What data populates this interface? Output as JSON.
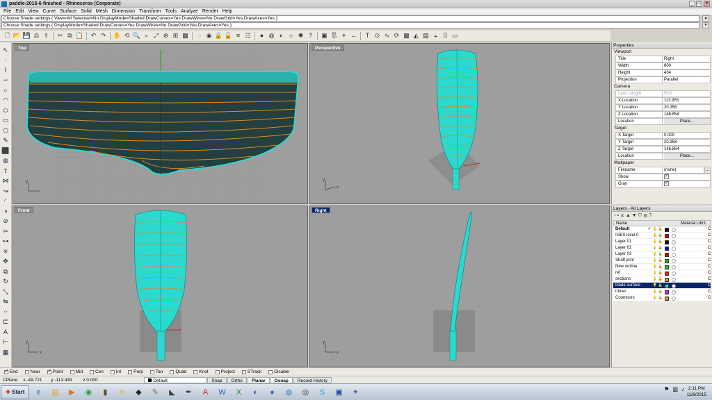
{
  "window": {
    "title": "paddle-2016-6-finished - Rhinoceros (Corporate)",
    "minimize": "_",
    "maximize": "□",
    "close": "✕"
  },
  "menu": [
    "File",
    "Edit",
    "View",
    "Curve",
    "Surface",
    "Solid",
    "Mesh",
    "Dimension",
    "Transform",
    "Tools",
    "Analyze",
    "Render",
    "Help"
  ],
  "command": {
    "history": "Choose Shade settings ( View=All  Selected=No  DisplayMode=Shaded  DrawCurves=Yes  DrawWires=No  DrawGrid=Yes  DrawAxes=Yes ):",
    "prompt": "Choose Shade settings ( DisplayMode=Shaded  DrawCurves=Yes  DrawWires=No  DrawGrid=Yes  DrawAxes=Yes ):"
  },
  "toolbar_icons": [
    "new-file-icon",
    "open-icon",
    "save-icon",
    "print-icon",
    "import-icon",
    "cut-icon",
    "copy-icon",
    "paste-icon",
    "undo-icon",
    "redo-icon",
    "pan-icon",
    "rotate-view-icon",
    "zoom-dynamic-icon",
    "zoom-window-icon",
    "zoom-extents-icon",
    "zoom-selected-icon",
    "four-view-icon",
    "grid-options-icon",
    "hide-icon",
    "show-icon",
    "lock-icon",
    "unlock-icon",
    "layer-icon",
    "properties-icon",
    "render-sphere-icon",
    "render-preview-icon",
    "material-icon",
    "light-icon",
    "sun-icon",
    "help-icon",
    "snapshot-icon",
    "six-view-icon",
    "analyze-icon",
    "dimension-icon",
    "text-icon",
    "osnap-icon",
    "curvature-icon",
    "history-icon",
    "mesh-icon",
    "draft-icon",
    "zebra-icon",
    "environment-icon",
    "camera-icon",
    "layout-icon"
  ],
  "toolbar_text": {
    "six_view": "6X\n3D"
  },
  "left_tool_icons": [
    "select-arrow-icon",
    "point-icon",
    "polyline-icon",
    "curve-icon",
    "circle-icon",
    "arc-icon",
    "ellipse-icon",
    "rectangle-icon",
    "polygon-icon",
    "free-form-icon",
    "box-icon",
    "sphere-icon",
    "extrude-icon",
    "loft-icon",
    "sweep-icon",
    "fillet-icon",
    "boolean-icon",
    "split-icon",
    "trim-icon",
    "join-icon",
    "explode-icon",
    "move-icon",
    "copy-tool-icon",
    "rotate-icon",
    "scale-icon",
    "mirror-icon",
    "array-icon",
    "offset-icon",
    "text-tool-icon",
    "dim-tool-icon",
    "mesh-tool-icon"
  ],
  "viewports": {
    "top": {
      "label": "Top"
    },
    "perspective": {
      "label": "Perspective"
    },
    "front": {
      "label": "Front"
    },
    "right": {
      "label": "Right"
    }
  },
  "axis": {
    "x": "x",
    "y": "y"
  },
  "colors": {
    "viewport_bg": "#9e9e9e",
    "blade": "#2bd9cf",
    "blade_dark": "#1f4f50",
    "contour": "#e08a1a",
    "selected_layer": "#0a246a"
  },
  "properties": {
    "header": "Properties",
    "sections": {
      "viewport": "Viewport",
      "camera": "Camera",
      "target": "Target",
      "wallpaper": "Wallpaper"
    },
    "viewport": [
      {
        "k": "Title",
        "v": "Right"
      },
      {
        "k": "Width",
        "v": "800"
      },
      {
        "k": "Height",
        "v": "434"
      },
      {
        "k": "Projection",
        "v": "Parallel"
      }
    ],
    "camera": [
      {
        "k": "Lens Length",
        "v": "50.0",
        "disabled": true
      },
      {
        "k": "X Location",
        "v": "113.953"
      },
      {
        "k": "Y Location",
        "v": "20.358"
      },
      {
        "k": "Z Location",
        "v": "146.854"
      },
      {
        "k": "Location",
        "v": "Place...",
        "button": true
      }
    ],
    "target": [
      {
        "k": "X Target",
        "v": "0.000"
      },
      {
        "k": "Y Target",
        "v": "20.358"
      },
      {
        "k": "Z Target",
        "v": "146.854"
      },
      {
        "k": "Location",
        "v": "Place...",
        "button": true
      }
    ],
    "wallpaper": {
      "filename_label": "Filename",
      "filename_value": "(none)",
      "show_label": "Show",
      "gray_label": "Gray",
      "browse": "..."
    }
  },
  "layers": {
    "header": "Layers - All Layers",
    "toolbar_icons": [
      "new-layer-icon",
      "new-sublayer-icon",
      "delete-layer-icon",
      "move-up-icon",
      "move-down-icon",
      "filter-icon",
      "layer-options-icon",
      "help-icon"
    ],
    "help_glyph": "?",
    "columns": {
      "name": "Name",
      "material": "Material Libr...",
      "linetype": "L"
    },
    "rows": [
      {
        "name": "Default",
        "check": "✓",
        "color": "#000000",
        "bold": true,
        "end": "C"
      },
      {
        "name": "IGES level 0",
        "color": "#e00000",
        "end": "Co"
      },
      {
        "name": "Layer 01",
        "color": "#000000",
        "end": "Co"
      },
      {
        "name": "Layer 02",
        "color": "#0000e0",
        "end": "Co"
      },
      {
        "name": "Layer 03",
        "color": "#e00000",
        "end": "Co"
      },
      {
        "name": "Shaft joint",
        "color": "#20c020",
        "end": "Co"
      },
      {
        "name": "New outline",
        "color": "#20c020",
        "end": "Co"
      },
      {
        "name": "ref",
        "color": "#e02020",
        "end": "Co"
      },
      {
        "name": "sections",
        "color": "#e08a1a",
        "end": "Co"
      },
      {
        "name": "blade surface",
        "color": "#2bd9cf",
        "selected": true,
        "end": "Co"
      },
      {
        "name": "trimer",
        "color": "#c030c0",
        "end": "Co"
      },
      {
        "name": "Countours",
        "color": "#e08a1a",
        "end": "Co"
      }
    ]
  },
  "osnaps": [
    {
      "label": "End",
      "on": true
    },
    {
      "label": "Near",
      "on": false
    },
    {
      "label": "Point",
      "on": true
    },
    {
      "label": "Mid",
      "on": false
    },
    {
      "label": "Cen",
      "on": false
    },
    {
      "label": "Int",
      "on": false
    },
    {
      "label": "Perp",
      "on": false
    },
    {
      "label": "Tan",
      "on": false
    },
    {
      "label": "Quad",
      "on": false
    },
    {
      "label": "Knot",
      "on": false
    },
    {
      "label": "Project",
      "on": false
    },
    {
      "label": "STrack",
      "on": false
    },
    {
      "label": "Disable",
      "on": false
    }
  ],
  "status": {
    "cplane": "CPlane",
    "x": "x -49.721",
    "y": "y -113.439",
    "z": "z 0.000",
    "layer": "Default",
    "toggles": [
      {
        "label": "Snap",
        "on": false
      },
      {
        "label": "Ortho",
        "on": false
      },
      {
        "label": "Planar",
        "on": true
      },
      {
        "label": "Osnap",
        "on": true
      },
      {
        "label": "Record History",
        "on": false
      }
    ]
  },
  "taskbar": {
    "start": "Start",
    "apps": [
      {
        "name": "ie-icon",
        "glyph": "e",
        "color": "#1e6fd0"
      },
      {
        "name": "explorer-icon",
        "glyph": "▤",
        "color": "#d9a520"
      },
      {
        "name": "media-player-icon",
        "glyph": "▶",
        "color": "#e07020"
      },
      {
        "name": "chrome-icon",
        "glyph": "◉",
        "color": "#2a9a3a"
      },
      {
        "name": "cup-icon",
        "glyph": "▮",
        "color": "#6a4a2a"
      },
      {
        "name": "illustrator-icon",
        "glyph": "Ai",
        "color": "#f0a000"
      },
      {
        "name": "3dsmax-icon",
        "glyph": "◆",
        "color": "#2a2a2a"
      },
      {
        "name": "gimp-icon",
        "glyph": "✎",
        "color": "#8a6a3a"
      },
      {
        "name": "rhino-icon",
        "glyph": "◣",
        "color": "#444444"
      },
      {
        "name": "inkscape-icon",
        "glyph": "✒",
        "color": "#333333"
      },
      {
        "name": "acrobat-icon",
        "glyph": "A",
        "color": "#c02020"
      },
      {
        "name": "word-icon",
        "glyph": "W",
        "color": "#2b5fb0"
      },
      {
        "name": "excel-icon",
        "glyph": "X",
        "color": "#1f7a3a"
      },
      {
        "name": "fishing-icon",
        "glyph": "◐",
        "color": "#1050a0"
      },
      {
        "name": "earth-icon",
        "glyph": "●",
        "color": "#3070c0"
      },
      {
        "name": "network-icon",
        "glyph": "◍",
        "color": "#4080b0"
      },
      {
        "name": "steam-icon",
        "glyph": "◎",
        "color": "#333333"
      },
      {
        "name": "skype-icon",
        "glyph": "S",
        "color": "#0a9ad8"
      },
      {
        "name": "virtualbox-icon",
        "glyph": "▣",
        "color": "#2050a0"
      },
      {
        "name": "kde-icon",
        "glyph": "✦",
        "color": "#5a5aa0"
      }
    ],
    "time": "2:11 PM",
    "date": "11/6/2015"
  }
}
